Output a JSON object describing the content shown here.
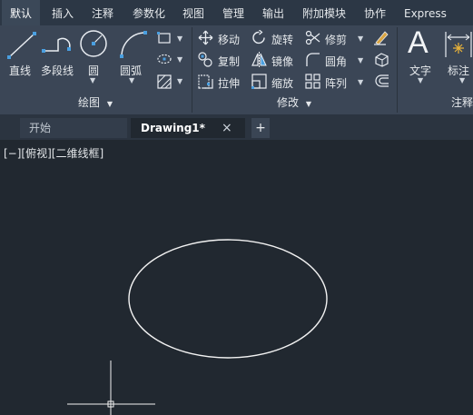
{
  "menu": {
    "items": [
      "默认",
      "插入",
      "注释",
      "参数化",
      "视图",
      "管理",
      "输出",
      "附加模块",
      "协作",
      "Express Tools"
    ]
  },
  "draw_panel": {
    "title": "绘图",
    "line": "直线",
    "polyline": "多段线",
    "circle": "圆",
    "arc": "圆弧"
  },
  "modify_panel": {
    "title": "修改",
    "move": "移动",
    "rotate": "旋转",
    "trim": "修剪",
    "copy": "复制",
    "mirror": "镜像",
    "fillet": "圆角",
    "stretch": "拉伸",
    "scale": "缩放",
    "array": "阵列"
  },
  "annotation_panel": {
    "title": "注释",
    "text": "文字",
    "dimension": "标注"
  },
  "tabs": {
    "start": "开始",
    "drawing": "Drawing1*",
    "close": "×",
    "add": "+"
  },
  "viewport": {
    "label": "[−][俯视][二维线框]"
  },
  "colors": {
    "menubar": "#2c3745",
    "ribbon": "#3b4656",
    "canvas": "#212830",
    "accent_blue": "#4a9fe0"
  }
}
